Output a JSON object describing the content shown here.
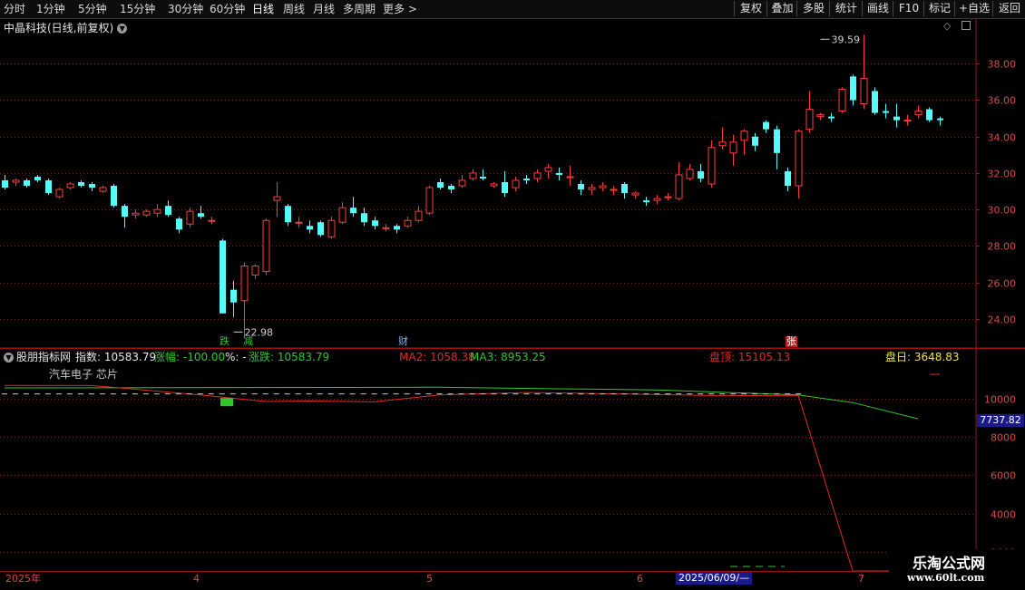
{
  "toolbar": {
    "periods": [
      "分时",
      "1分钟",
      "5分钟",
      "15分钟",
      "30分钟",
      "60分钟",
      "日线",
      "周线",
      "月线",
      "多周期",
      "更多 >"
    ],
    "active_period": "日线",
    "buttons": [
      "复权",
      "叠加",
      "多股",
      "统计",
      "画线",
      "F10",
      "标记",
      "+自选",
      "返回"
    ]
  },
  "main": {
    "title": "中晶科技(日线,前复权)",
    "max_label": "39.59",
    "min_label": "22.98",
    "flags": {
      "die": "跌",
      "jian": "减",
      "cai": "财",
      "zhang": "张"
    }
  },
  "sub": {
    "indicator_name": "股朋指标网",
    "index_label": "指数: 10583.79",
    "zhangfu_label": "涨幅: -100.00",
    "pct_label": "%: -",
    "zhangdie_label": "涨跌: 10583.79",
    "ma2_label": "MA2: 1058.38",
    "ma3_label": "MA3: 8953.25",
    "panding_label": "盘顶: 15105.13",
    "panri_label": "盘日: 3648.83",
    "sector_label": "汽车电子 芯片",
    "cursor_value": "7737.82"
  },
  "date_bar": {
    "labels": [
      "2025年",
      "4",
      "5",
      "6",
      "7"
    ],
    "cursor_date": "2025/06/09/—"
  },
  "watermark": {
    "line1": "乐淘公式网",
    "line2": "www.60lt.com"
  },
  "colors": {
    "up": "#ff3c3c",
    "down": "#54fcfc",
    "bg": "#000000",
    "grid": "#8b1c1c",
    "axis_text": "#d74a4a",
    "ma_green": "#2ec82e",
    "ma_red": "#e02a2a"
  },
  "chart_data": [
    {
      "type": "candlestick",
      "title": "中晶科技(日线,前复权)",
      "y_ticks": [
        24.0,
        26.0,
        28.0,
        30.0,
        32.0,
        34.0,
        36.0,
        38.0
      ],
      "ylim": [
        22.4,
        40.5
      ],
      "annotations": [
        {
          "label": "39.59",
          "value": 39.59,
          "index": 75
        },
        {
          "label": "22.98",
          "value": 22.98,
          "index": 21
        }
      ],
      "candles": [
        [
          31.6,
          31.2,
          31.9,
          31.1
        ],
        [
          31.5,
          31.6,
          31.7,
          31.3
        ],
        [
          31.6,
          31.3,
          31.7,
          31.2
        ],
        [
          31.8,
          31.6,
          31.9,
          31.5
        ],
        [
          31.6,
          30.9,
          31.7,
          30.8
        ],
        [
          30.7,
          31.1,
          31.2,
          30.6
        ],
        [
          31.2,
          31.4,
          31.5,
          31.1
        ],
        [
          31.5,
          31.3,
          31.6,
          31.2
        ],
        [
          31.4,
          31.2,
          31.5,
          31.0
        ],
        [
          31.0,
          31.2,
          31.3,
          30.9
        ],
        [
          31.3,
          30.2,
          31.4,
          30.1
        ],
        [
          30.2,
          29.6,
          30.3,
          29.0
        ],
        [
          29.7,
          29.8,
          30.0,
          29.5
        ],
        [
          29.7,
          29.9,
          30.0,
          29.6
        ],
        [
          29.8,
          30.0,
          30.3,
          29.6
        ],
        [
          30.2,
          29.7,
          30.5,
          29.6
        ],
        [
          29.5,
          28.9,
          29.6,
          28.7
        ],
        [
          29.2,
          29.9,
          30.1,
          29.0
        ],
        [
          29.8,
          29.6,
          30.2,
          29.5
        ],
        [
          29.4,
          29.4,
          29.6,
          29.2
        ],
        [
          28.3,
          24.3,
          28.4,
          24.3
        ],
        [
          25.6,
          24.9,
          26.1,
          24.1
        ],
        [
          25.0,
          26.9,
          27.1,
          22.98
        ],
        [
          26.4,
          26.9,
          27.0,
          26.2
        ],
        [
          26.6,
          29.4,
          29.5,
          26.4
        ],
        [
          30.5,
          30.7,
          31.5,
          29.6
        ],
        [
          30.2,
          29.3,
          30.3,
          29.1
        ],
        [
          29.3,
          29.3,
          29.6,
          29.0
        ],
        [
          29.1,
          28.9,
          29.4,
          28.7
        ],
        [
          29.3,
          28.6,
          29.4,
          28.5
        ],
        [
          28.5,
          29.4,
          29.6,
          28.4
        ],
        [
          29.3,
          30.1,
          30.4,
          29.2
        ],
        [
          30.1,
          29.8,
          30.7,
          29.6
        ],
        [
          29.8,
          29.3,
          30.1,
          29.1
        ],
        [
          29.4,
          29.1,
          29.6,
          28.9
        ],
        [
          29.0,
          29.0,
          29.2,
          28.8
        ],
        [
          29.1,
          28.9,
          29.2,
          28.7
        ],
        [
          29.1,
          29.4,
          29.6,
          29.0
        ],
        [
          29.4,
          29.9,
          30.2,
          29.3
        ],
        [
          29.8,
          31.2,
          31.3,
          29.7
        ],
        [
          31.5,
          31.2,
          31.7,
          31.1
        ],
        [
          31.3,
          31.1,
          31.4,
          30.9
        ],
        [
          31.3,
          31.6,
          31.9,
          31.2
        ],
        [
          31.7,
          32.0,
          32.2,
          31.6
        ],
        [
          31.8,
          31.7,
          32.2,
          31.6
        ],
        [
          31.3,
          31.4,
          31.5,
          31.2
        ],
        [
          31.5,
          30.9,
          32.1,
          30.7
        ],
        [
          31.2,
          31.6,
          31.8,
          31.0
        ],
        [
          31.7,
          31.6,
          31.9,
          31.4
        ],
        [
          31.7,
          32.0,
          32.2,
          31.5
        ],
        [
          32.1,
          32.3,
          32.5,
          31.7
        ],
        [
          32.0,
          31.9,
          32.3,
          31.6
        ],
        [
          31.8,
          31.8,
          32.4,
          31.3
        ],
        [
          31.4,
          31.1,
          31.6,
          30.8
        ],
        [
          31.1,
          31.2,
          31.4,
          30.8
        ],
        [
          31.2,
          31.3,
          31.5,
          31.0
        ],
        [
          31.1,
          31.1,
          31.3,
          30.8
        ],
        [
          31.4,
          30.9,
          31.5,
          30.6
        ],
        [
          30.8,
          30.9,
          31.0,
          30.6
        ],
        [
          30.5,
          30.4,
          30.7,
          30.2
        ],
        [
          30.5,
          30.6,
          30.8,
          30.3
        ],
        [
          30.7,
          30.7,
          30.9,
          30.5
        ],
        [
          30.6,
          31.9,
          32.6,
          30.5
        ],
        [
          31.7,
          32.2,
          32.5,
          31.6
        ],
        [
          32.1,
          31.7,
          32.5,
          31.5
        ],
        [
          31.4,
          33.4,
          33.8,
          31.2
        ],
        [
          33.5,
          33.7,
          34.5,
          33.3
        ],
        [
          33.1,
          33.7,
          34.1,
          32.4
        ],
        [
          33.8,
          34.3,
          34.4,
          33.0
        ],
        [
          34.0,
          33.5,
          34.2,
          33.2
        ],
        [
          34.8,
          34.4,
          34.9,
          34.2
        ],
        [
          34.4,
          33.1,
          34.6,
          32.2
        ],
        [
          32.1,
          31.3,
          32.3,
          31.0
        ],
        [
          31.3,
          34.3,
          34.4,
          30.6
        ],
        [
          34.4,
          35.5,
          36.5,
          34.2
        ],
        [
          35.1,
          35.2,
          35.3,
          34.9
        ],
        [
          35.1,
          35.0,
          35.3,
          34.8
        ],
        [
          35.4,
          36.6,
          36.7,
          35.3
        ],
        [
          37.3,
          36.0,
          37.4,
          35.7
        ],
        [
          35.8,
          37.2,
          39.59,
          35.5
        ],
        [
          36.5,
          35.3,
          36.7,
          35.2
        ],
        [
          35.4,
          35.3,
          35.8,
          35.0
        ],
        [
          35.1,
          34.9,
          35.8,
          34.5
        ],
        [
          34.9,
          34.9,
          35.2,
          34.6
        ],
        [
          35.2,
          35.4,
          35.7,
          35.0
        ],
        [
          35.5,
          34.9,
          35.6,
          34.8
        ],
        [
          35.0,
          34.9,
          35.1,
          34.6
        ]
      ]
    },
    {
      "type": "line",
      "title": "股朋指标网",
      "y_ticks": [
        2000,
        4000,
        6000,
        8000,
        10000
      ],
      "ylim": [
        1000,
        11800
      ],
      "series": [
        {
          "name": "MA3",
          "color": "#2ec82e",
          "points": [
            [
              0,
              10570
            ],
            [
              40,
              10600
            ],
            [
              60,
              10460
            ],
            [
              73,
              10200
            ],
            [
              78,
              9800
            ],
            [
              84,
              8953
            ]
          ]
        },
        {
          "name": "盘顶",
          "color": "#e02a2a",
          "points": [
            [
              0,
              10700
            ],
            [
              8,
              10690
            ],
            [
              11,
              10550
            ],
            [
              18,
              10200
            ],
            [
              24,
              9860
            ],
            [
              28,
              9880
            ],
            [
              34,
              9840
            ],
            [
              40,
              10200
            ],
            [
              48,
              10330
            ],
            [
              56,
              10260
            ],
            [
              64,
              10180
            ],
            [
              73,
              10150
            ],
            [
              78,
              1000
            ],
            [
              84,
              1000
            ]
          ]
        }
      ]
    }
  ]
}
